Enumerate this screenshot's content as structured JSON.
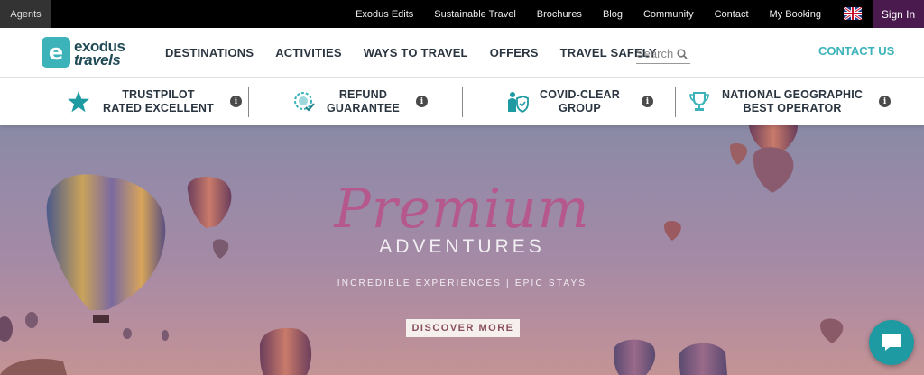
{
  "topbar": {
    "agents": "Agents",
    "links": [
      "Exodus Edits",
      "Sustainable Travel",
      "Brochures",
      "Blog",
      "Community",
      "Contact",
      "My Booking"
    ],
    "flag_icon": "uk-flag-icon",
    "sign_in": "Sign In"
  },
  "logo": {
    "line1": "exodus",
    "line2": "travels",
    "mark": "e"
  },
  "nav": {
    "items": [
      "DESTINATIONS",
      "ACTIVITIES",
      "WAYS TO TRAVEL",
      "OFFERS",
      "TRAVEL SAFELY"
    ],
    "search_placeholder": "Search",
    "contact": "CONTACT US"
  },
  "features": [
    {
      "line1": "TRUSTPILOT",
      "line2": "RATED EXCELLENT",
      "icon": "star-icon"
    },
    {
      "line1": "REFUND",
      "line2": "GUARANTEE",
      "icon": "refund-badge-icon"
    },
    {
      "line1": "COVID-CLEAR",
      "line2": "GROUP",
      "icon": "shield-person-icon"
    },
    {
      "line1": "NATIONAL GEOGRAPHIC",
      "line2": "BEST OPERATOR",
      "icon": "trophy-icon"
    }
  ],
  "info_glyph": "i",
  "hero": {
    "title": "Premium",
    "subtitle": "ADVENTURES",
    "tagline": "INCREDIBLE EXPERIENCES | EPIC STAYS",
    "cta": "DISCOVER MORE"
  },
  "colors": {
    "accent": "#3bb3b9",
    "signin_bg": "#4a1a4e",
    "hero_title": "#b5588e",
    "chat": "#1e9aa3"
  }
}
